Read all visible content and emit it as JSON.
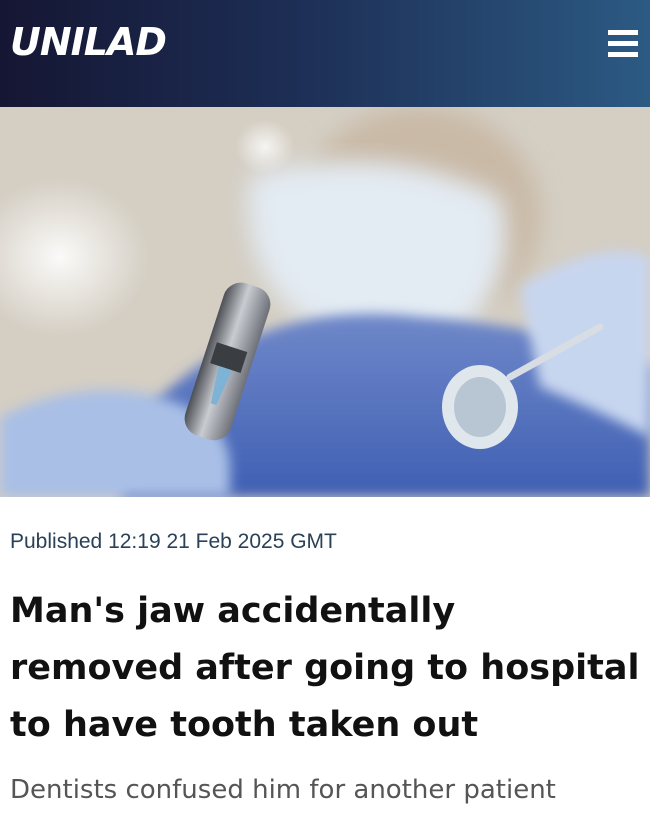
{
  "header": {
    "logo_text": "UNILAD",
    "menu_icon": "hamburger-menu-icon",
    "gradient_colors": [
      "#151633",
      "#2c5a83"
    ]
  },
  "hero_image": {
    "icon": "dentist-photo"
  },
  "article": {
    "published": "Published 12:19 21 Feb 2025 GMT",
    "headline": "Man's jaw accidentally removed after going to hospital to have tooth taken out",
    "subheadline": "Dentists confused him for another patient"
  }
}
